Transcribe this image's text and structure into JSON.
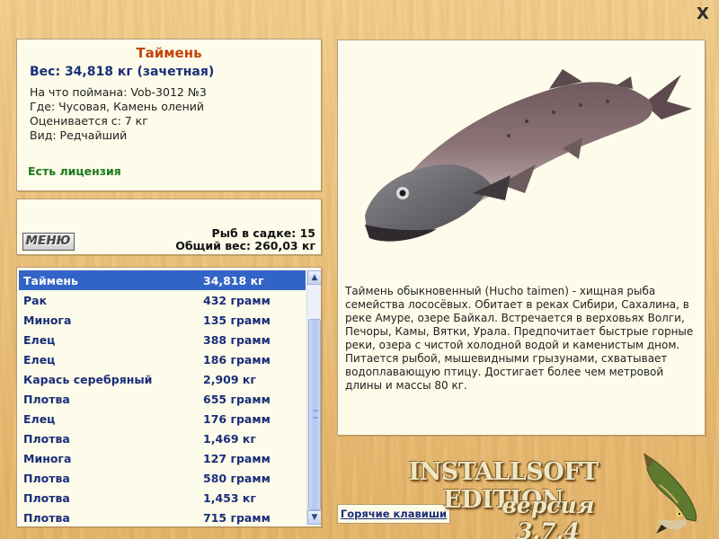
{
  "window": {
    "close_label": "X"
  },
  "info": {
    "name": "Таймень",
    "weight": "Вес: 34,818 кг (зачетная)",
    "bait": "На что поймана: Vob-3012 №3",
    "location": "Где: Чусовая, Камень олений",
    "valued_from": "Оценивается с: 7 кг",
    "kind": "Вид: Редчайший",
    "license": "Есть лицензия"
  },
  "stats": {
    "menu_label": "МЕНЮ",
    "fish_count": "Рыб в садке: 15",
    "total_weight": "Общий вес: 260,03 кг"
  },
  "catch_list": {
    "selected_index": 0,
    "items": [
      {
        "name": "Таймень",
        "weight": "34,818 кг"
      },
      {
        "name": "Рак",
        "weight": "432 грамм"
      },
      {
        "name": "Минога",
        "weight": "135 грамм"
      },
      {
        "name": "Елец",
        "weight": "388 грамм"
      },
      {
        "name": "Елец",
        "weight": "186 грамм"
      },
      {
        "name": "Карась серебряный",
        "weight": "2,909 кг"
      },
      {
        "name": "Плотва",
        "weight": "655 грамм"
      },
      {
        "name": "Елец",
        "weight": "176 грамм"
      },
      {
        "name": "Плотва",
        "weight": "1,469 кг"
      },
      {
        "name": "Минога",
        "weight": "127 грамм"
      },
      {
        "name": "Плотва",
        "weight": "580 грамм"
      },
      {
        "name": "Плотва",
        "weight": "1,453 кг"
      },
      {
        "name": "Плотва",
        "weight": "715 грамм"
      }
    ],
    "scroll_up_icon": "arrow-up-icon",
    "scroll_down_icon": "arrow-down-icon"
  },
  "fish_panel": {
    "description": "Таймень обыкновенный (Hucho taimen) - хищная рыба семейства лососёвых. Обитает в реках Сибири, Сахалина, в реке Амуре, озере Байкал. Встречается в верховьях Волги, Печоры, Камы, Вятки, Урала. Предпочитает быстрые горные реки, озера с чистой холодной водой и каменистым дном. Питается рыбой, мышевидными грызунами, схватывает водоплавающую птицу. Достигает более чем метровой длины и массы 80 кг."
  },
  "footer": {
    "hotkeys_label": "Горячие клавиши",
    "brand": "INSTALLSOFT EDITION",
    "version": "версия 3.7.4"
  },
  "colors": {
    "background": "#efc682",
    "panel": "#fdfbe9",
    "title_orange": "#c2460d",
    "text_blue": "#1a2e7a",
    "license_green": "#1b7a1b",
    "selection": "#3264c8"
  }
}
